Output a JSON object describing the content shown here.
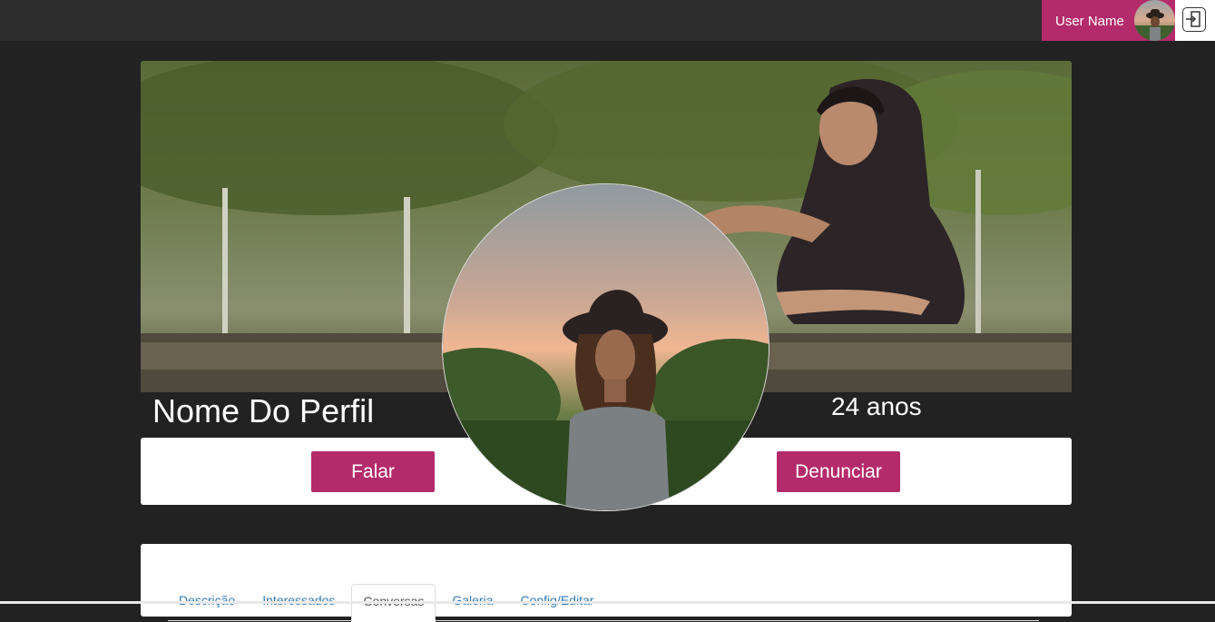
{
  "header": {
    "user_name": "User Name",
    "avatar_icon": "user-avatar",
    "logout_icon": "logout-icon"
  },
  "profile": {
    "name": "Nome Do Perfil",
    "age": "24 anos",
    "cover_image": "cover-photo",
    "avatar_image": "profile-photo"
  },
  "actions": {
    "talk_label": "Falar",
    "report_label": "Denunciar"
  },
  "tabs": [
    {
      "label": "Descrição",
      "active": false
    },
    {
      "label": "Interessados",
      "active": false
    },
    {
      "label": "Conversas",
      "active": true
    },
    {
      "label": "Galeria",
      "active": false
    },
    {
      "label": "Config/Editar",
      "active": false
    }
  ],
  "colors": {
    "accent": "#b42b6b",
    "background": "#222222",
    "topbar": "#2d2d2d"
  }
}
